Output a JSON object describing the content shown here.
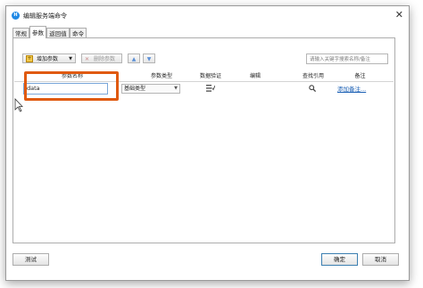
{
  "window": {
    "title": "编辑服务端命令",
    "app_icon_glyph": "H",
    "close_glyph": "✕"
  },
  "tabs": [
    {
      "label": "常规",
      "active": false
    },
    {
      "label": "参数",
      "active": true
    },
    {
      "label": "返回值",
      "active": false
    },
    {
      "label": "命令",
      "active": false
    }
  ],
  "toolbar": {
    "add_label": "增加参数",
    "add_icon_glyph": "+",
    "add_dropdown_glyph": "▼",
    "delete_label": "删除参数",
    "delete_icon_glyph": "✕",
    "up_glyph": "▲",
    "down_glyph": "▼",
    "search_placeholder": "请输入关键字搜索名称/备注"
  },
  "grid": {
    "columns": [
      "参数名称",
      "参数类型",
      "数据验证",
      "编辑",
      "查找引用",
      "备注"
    ],
    "rows": [
      {
        "name": "data",
        "type": "基础类型",
        "type_arrow": "▼",
        "remark": "添加备注..."
      }
    ]
  },
  "footer": {
    "test_label": "测试",
    "ok_label": "确定",
    "cancel_label": "取消"
  },
  "colors": {
    "highlight": "#e05a10",
    "link": "#1a5fb4",
    "accent": "#1e88e5"
  }
}
